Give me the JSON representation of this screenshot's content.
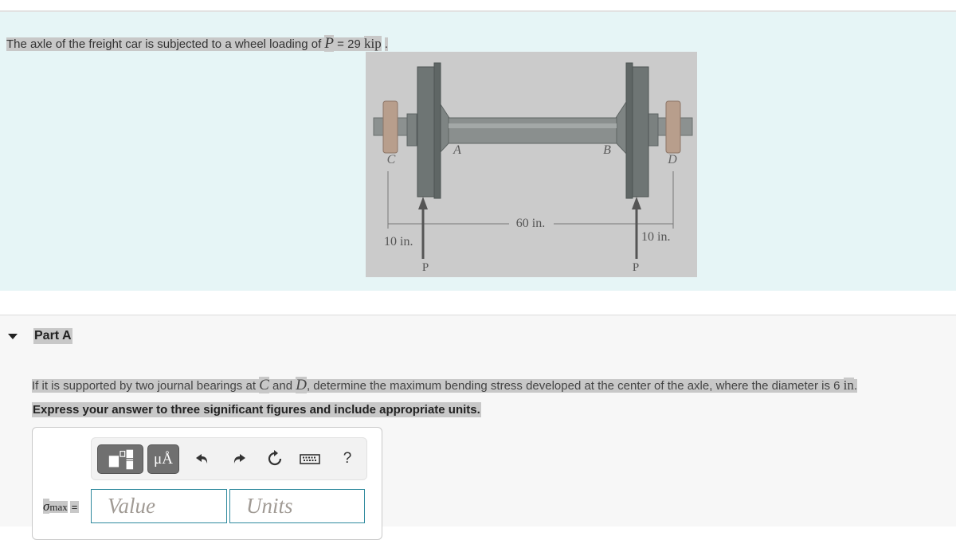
{
  "intro": {
    "text_before": "The axle of the freight car is subjected to a wheel loading of ",
    "variable": "P",
    "equals_value": " = 29 ",
    "unit": "kip",
    "period": "."
  },
  "figure": {
    "labels": {
      "C": "C",
      "A": "A",
      "B": "B",
      "D": "D"
    },
    "dimensions": {
      "left": "10 in.",
      "middle": "60 in.",
      "right": "10 in."
    },
    "loads": {
      "left": "P",
      "right": "P"
    },
    "colors": {
      "wheel": "#6e7574",
      "axle": "#8a8f8e",
      "bearing": "#b89e8c",
      "background": "#cbcbcb"
    }
  },
  "part": {
    "title": "Part A",
    "question": {
      "before": "If it is supported by two journal bearings at ",
      "var1": "C",
      "mid": " and ",
      "var2": "D",
      "after": ", determine the maximum bending stress developed at the center of the axle, where the diameter is 6 ",
      "unit": "in",
      "period": "."
    },
    "instruction": "Express your answer to three significant figures and include appropriate units."
  },
  "answer": {
    "toolbar": {
      "templates_icon": "templates-icon",
      "units_label": "μÅ",
      "undo_icon": "undo-icon",
      "redo_icon": "redo-icon",
      "reset_icon": "reset-icon",
      "keyboard_icon": "keyboard-icon",
      "help_label": "?"
    },
    "label_symbol": "σ",
    "label_subscript": "max",
    "label_equals": "=",
    "value_placeholder": "Value",
    "units_placeholder": "Units",
    "value": "",
    "units": ""
  }
}
